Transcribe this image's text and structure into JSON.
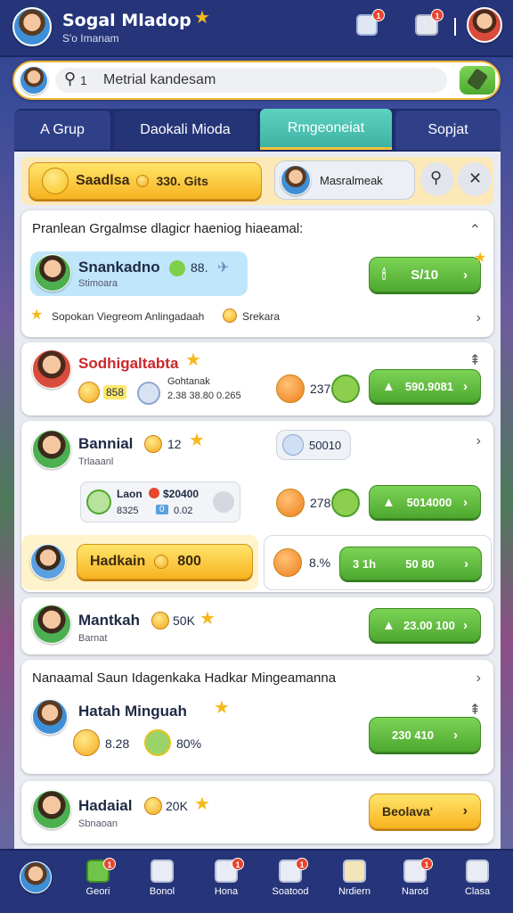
{
  "app": {
    "title": "Sogal Mladop",
    "subtitle": "S'o Imanam"
  },
  "search": {
    "text": "Metrial kandesam",
    "prefix": "1"
  },
  "tabs": [
    {
      "label": "A Grup"
    },
    {
      "label": "Daokali Mioda"
    },
    {
      "label": "Rmgeoneiat"
    },
    {
      "label": "Sopjat"
    }
  ],
  "top_card": {
    "name_btn": "Saadlsa",
    "coin_value": "330. Gits",
    "player_label": "Masralmeak"
  },
  "section1": {
    "heading": "Pranlean Grgalmse dlagicr haeniog hiaeamal:",
    "player": {
      "name": "Snankadno",
      "value": "88.",
      "sub": "Stimoara"
    },
    "btn": "S/10",
    "footer": "Sopokan Viegreom Anlingadaah",
    "footer2": "Srekara"
  },
  "card2": {
    "name": "Sodhigaltabta",
    "stat1": "858",
    "sub1": "Gohtanak",
    "sub2": "2.38 38.80 0.265",
    "value": "237",
    "btn": "590.9081"
  },
  "card3": {
    "name": "Bannial",
    "value": "12",
    "sub": "Trlaaanl",
    "pill": "50010",
    "mini_title": "Laon",
    "mini_value": "$20400",
    "mini_sub1": "8325",
    "mini_sub2": "0",
    "mini_sub3": "0.02",
    "stat": "278",
    "btn": "5014000",
    "yellow_btn": "Hadkain",
    "yellow_value": "800",
    "box_value": "8.%",
    "box_pre": "3 1h",
    "box_btn": "50 80"
  },
  "card4": {
    "name": "Mantkah",
    "value": "50K",
    "sub": "Barnat",
    "btn": "23.00 100"
  },
  "section2": {
    "heading": "Nanaamal Saun Idagenkaka Hadkar Mingeamanna",
    "player": "Hatah Minguah",
    "stat1": "8.28",
    "stat2": "80%",
    "btn": "230 410"
  },
  "card6": {
    "name": "Hadaial",
    "value": "20K",
    "sub": "Sbnaoan",
    "btn": "Beolava'"
  },
  "nav": [
    {
      "label": ""
    },
    {
      "label": "Geori"
    },
    {
      "label": "Bonol"
    },
    {
      "label": "Hona"
    },
    {
      "label": "Soatood"
    },
    {
      "label": "Nrdiern"
    },
    {
      "label": "Narod"
    },
    {
      "label": "Clasa"
    }
  ],
  "badges": {
    "b1": "1",
    "b2": "1",
    "nav1": "1",
    "nav3": "1",
    "nav4": "1",
    "nav6": "1"
  }
}
